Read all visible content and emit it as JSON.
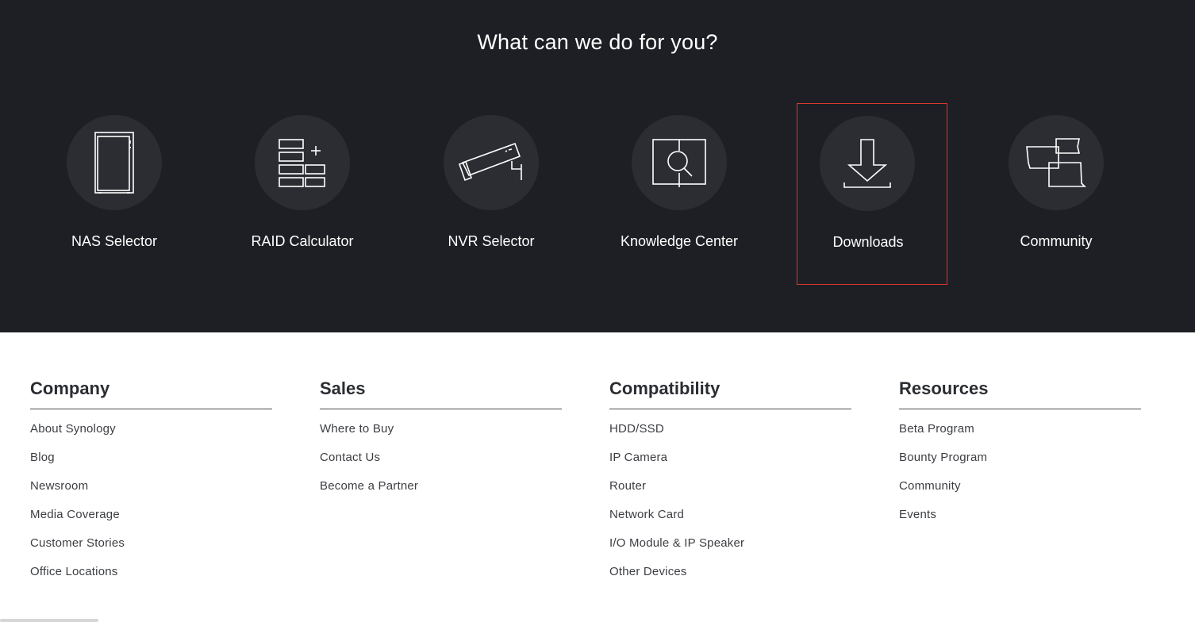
{
  "hero": {
    "title": "What can we do for you?",
    "tools": [
      {
        "label": "NAS Selector",
        "icon": "nas-icon"
      },
      {
        "label": "RAID Calculator",
        "icon": "raid-calculator-icon"
      },
      {
        "label": "NVR Selector",
        "icon": "surveillance-camera-icon"
      },
      {
        "label": "Knowledge Center",
        "icon": "book-search-icon"
      },
      {
        "label": "Downloads",
        "icon": "download-icon"
      },
      {
        "label": "Community",
        "icon": "chat-bubbles-icon"
      }
    ],
    "highlight_color": "#d9382f"
  },
  "footer": {
    "company": {
      "heading": "Company",
      "links": [
        "About Synology",
        "Blog",
        "Newsroom",
        "Media Coverage",
        "Customer Stories",
        "Office Locations"
      ]
    },
    "sales": {
      "heading": "Sales",
      "links": [
        "Where to Buy",
        "Contact Us",
        "Become a Partner"
      ]
    },
    "compatibility": {
      "heading": "Compatibility",
      "links": [
        "HDD/SSD",
        "IP Camera",
        "Router",
        "Network Card",
        "I/O Module & IP Speaker",
        "Other Devices"
      ]
    },
    "resources": {
      "heading": "Resources",
      "links": [
        "Beta Program",
        "Bounty Program",
        "Community",
        "Events"
      ]
    }
  }
}
